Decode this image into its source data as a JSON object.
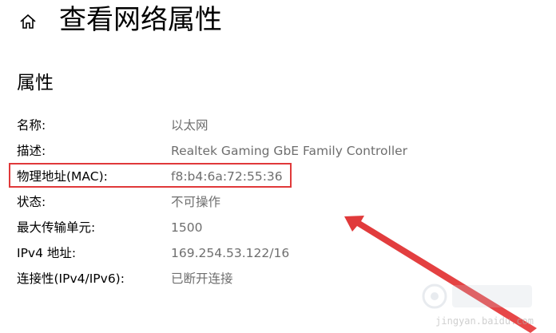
{
  "header": {
    "home_icon": "home-icon",
    "title": "查看网络属性"
  },
  "section": {
    "title": "属性"
  },
  "properties": [
    {
      "label": "名称:",
      "value": "以太网"
    },
    {
      "label": "描述:",
      "value": "Realtek Gaming GbE Family Controller"
    },
    {
      "label": "物理地址(MAC):",
      "value": "f8:b4:6a:72:55:36"
    },
    {
      "label": "状态:",
      "value": "不可操作"
    },
    {
      "label": "最大传输单元:",
      "value": "1500"
    },
    {
      "label": "IPv4 地址:",
      "value": "169.254.53.122/16"
    },
    {
      "label": "连接性(IPv4/IPv6):",
      "value": "已断开连接"
    }
  ],
  "annotation": {
    "highlight_color": "#e0393a",
    "arrow_color": "#e0393a"
  },
  "watermark": {
    "text": "Bai经验",
    "url": "jingyan.baidu.com"
  }
}
